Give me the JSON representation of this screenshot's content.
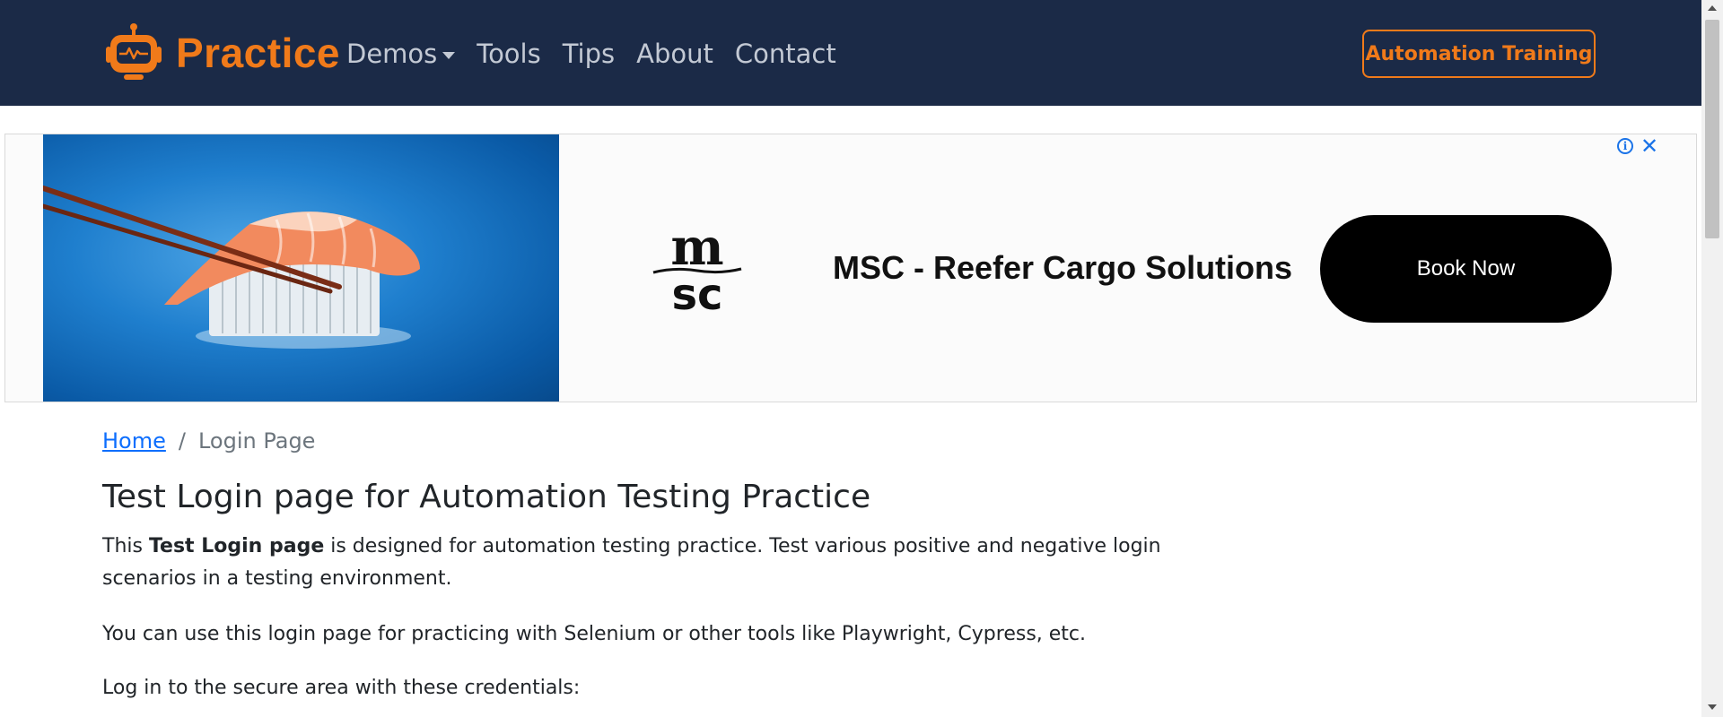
{
  "navbar": {
    "brand": "Practice",
    "links": [
      "Demos",
      "Tools",
      "Tips",
      "About",
      "Contact"
    ],
    "cta": "Automation Training",
    "colors": {
      "background": "#1b2a47",
      "accent": "#f07a1a",
      "link": "#c3c9d4"
    }
  },
  "ad": {
    "headline": "MSC - Reefer Cargo Solutions",
    "button": "Book Now",
    "logo_text_top": "m",
    "logo_text_bottom": "sc",
    "info_icon": "info-icon",
    "close_icon": "close-icon",
    "close_glyph": "✕",
    "info_glyph": "i"
  },
  "breadcrumb": {
    "home": "Home",
    "separator": "/",
    "current": "Login Page"
  },
  "content": {
    "title": "Test Login page for Automation Testing Practice",
    "p1_prefix": "This ",
    "p1_bold": "Test Login page",
    "p1_suffix": " is designed for automation testing practice. Test various positive and negative login scenarios in a testing environment.",
    "p2": "You can use this login page for practicing with Selenium or other tools like Playwright, Cypress, etc.",
    "p3": "Log in to the secure area with these credentials:"
  }
}
